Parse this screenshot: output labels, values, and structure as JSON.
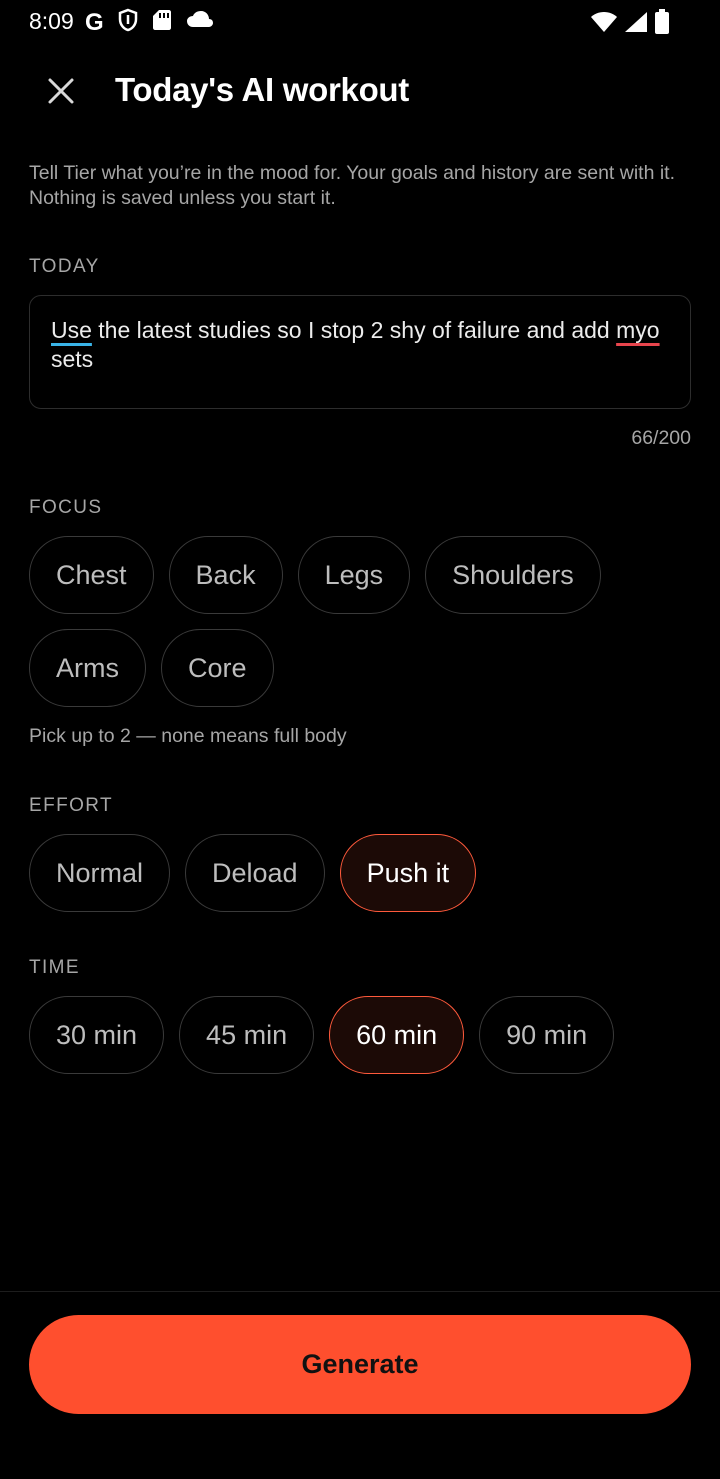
{
  "status_bar": {
    "time": "8:09",
    "left_icons": [
      "google-icon",
      "shield-icon",
      "sd-card-icon",
      "cloud-icon"
    ],
    "right_icons": [
      "wifi-icon",
      "signal-icon",
      "battery-icon"
    ]
  },
  "header": {
    "title": "Today's AI workout"
  },
  "description": "Tell Tier what you’re in the mood for. Your goals and history are sent with it. Nothing is saved unless you start it.",
  "today": {
    "label": "TODAY",
    "prompt_words": [
      "Use",
      " the latest studies so I stop 2 shy of failure and add ",
      "myo",
      " sets"
    ],
    "char_count": "66/200"
  },
  "focus": {
    "label": "FOCUS",
    "options": [
      "Chest",
      "Back",
      "Legs",
      "Shoulders",
      "Arms",
      "Core"
    ],
    "helper": "Pick up to 2 — none means full body"
  },
  "effort": {
    "label": "EFFORT",
    "options": [
      "Normal",
      "Deload",
      "Push it"
    ],
    "selected": "Push it"
  },
  "time": {
    "label": "TIME",
    "options": [
      "30 min",
      "45 min",
      "60 min",
      "90 min"
    ],
    "selected": "60 min"
  },
  "generate_label": "Generate",
  "colors": {
    "accent": "#ff4f2e",
    "selected_border": "#ff5a3c",
    "background": "#000000",
    "muted_text": "#a6a6a6"
  }
}
